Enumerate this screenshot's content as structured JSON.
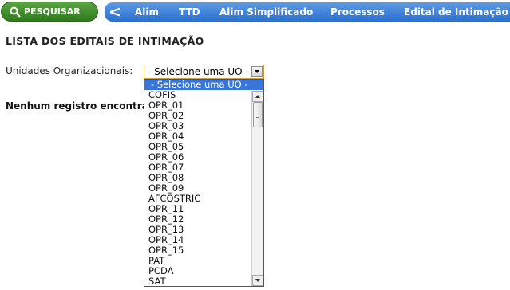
{
  "toolbar": {
    "search_label": "PESQUISAR",
    "search_icon": "magnifier-icon",
    "back_label": "<",
    "nav_items": [
      "Alim",
      "TTD",
      "Alim Simplificado",
      "Processos",
      "Edital de Intimação"
    ]
  },
  "page": {
    "title": "LISTA DOS EDITAIS DE INTIMAÇÃO",
    "uo_label": "Unidades Organizacionais:",
    "no_records": "Nenhum registro encontrado"
  },
  "uo_select": {
    "selected": "- Selecione uma UO -",
    "options": [
      "- Selecione uma UO -",
      "COFIS",
      "OPR_01",
      "OPR_02",
      "OPR_03",
      "OPR_04",
      "OPR_05",
      "OPR_06",
      "OPR_07",
      "OPR_08",
      "OPR_09",
      "AFCOSTRIC",
      "OPR_11",
      "OPR_12",
      "OPR_13",
      "OPR_14",
      "OPR_15",
      "PAT",
      "PCDA",
      "SAT"
    ]
  },
  "colors": {
    "green_button": "#3a8a26",
    "nav_blue": "#3a7fd8",
    "selected_option": "#3875d7"
  }
}
